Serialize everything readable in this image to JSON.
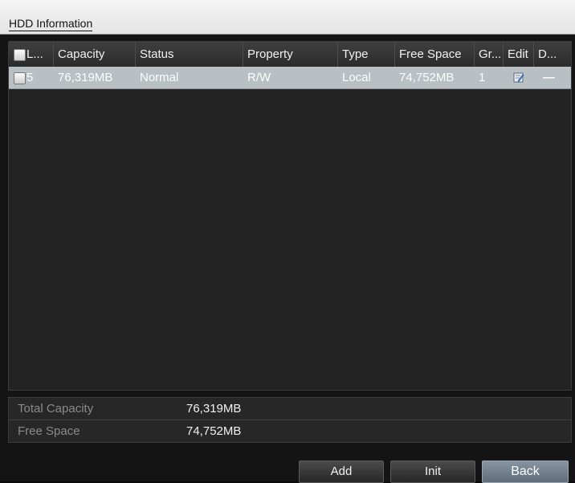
{
  "window": {
    "title": "HDD Information"
  },
  "table": {
    "columns": [
      "L...",
      "Capacity",
      "Status",
      "Property",
      "Type",
      "Free Space",
      "Gr...",
      "Edit",
      "D..."
    ],
    "rows": [
      {
        "label": "5",
        "capacity": "76,319MB",
        "status": "Normal",
        "property": "R/W",
        "type": "Local",
        "free_space": "74,752MB",
        "group": "1",
        "edit_icon": "edit-icon",
        "delete": "—"
      }
    ]
  },
  "summary": {
    "total_capacity_label": "Total Capacity",
    "total_capacity_value": "76,319MB",
    "free_space_label": "Free Space",
    "free_space_value": "74,752MB"
  },
  "buttons": {
    "add": "Add",
    "init": "Init",
    "back": "Back"
  },
  "colors": {
    "selected_row": "#b9c0c4",
    "back_button": "#7684929"
  }
}
